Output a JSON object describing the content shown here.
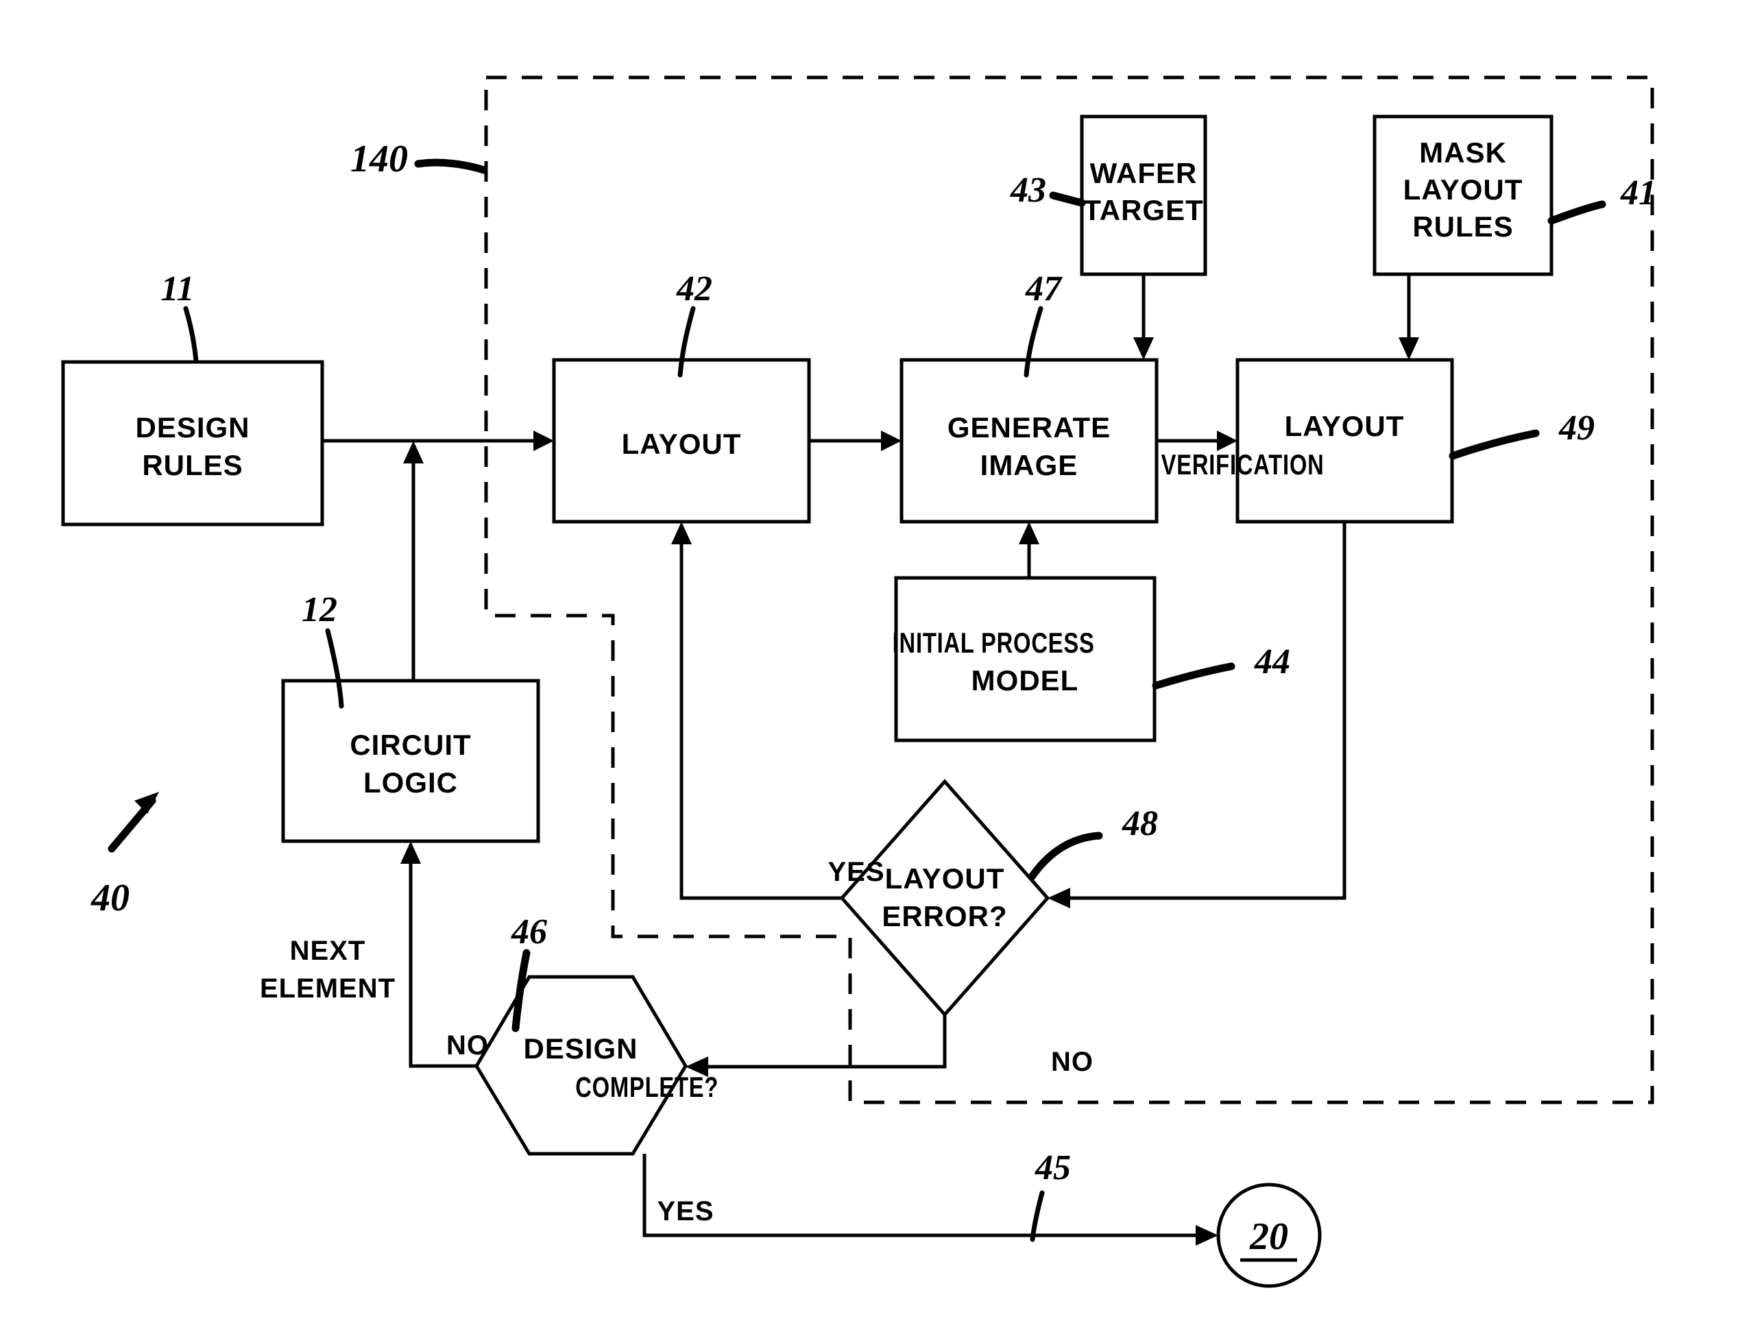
{
  "figure": {
    "type": "patent-flowchart",
    "system_ref": "40",
    "dashed_region_ref": "140"
  },
  "boxes": {
    "design_rules": {
      "label_line1": "DESIGN",
      "label_line2": "RULES",
      "ref": "11"
    },
    "circuit_logic": {
      "label_line1": "CIRCUIT",
      "label_line2": "LOGIC",
      "ref": "12"
    },
    "layout": {
      "label_line1": "LAYOUT",
      "ref": "42"
    },
    "generate_image": {
      "label_line1": "GENERATE",
      "label_line2": "IMAGE",
      "ref": "47"
    },
    "wafer_target": {
      "label_line1": "WAFER",
      "label_line2": "TARGET",
      "ref": "43"
    },
    "mask_layout_rules": {
      "label_line1": "MASK",
      "label_line2": "LAYOUT",
      "label_line3": "RULES",
      "ref": "41"
    },
    "layout_verification": {
      "label_line1": "LAYOUT",
      "label_line2": "VERIFICATION",
      "ref": "49"
    },
    "initial_process_model": {
      "label_line1": "INITIAL PROCESS",
      "label_line2": "MODEL",
      "ref": "44"
    }
  },
  "decisions": {
    "layout_error": {
      "label_line1": "LAYOUT",
      "label_line2": "ERROR?",
      "ref": "48",
      "yes_label": "YES",
      "no_label": "NO"
    },
    "design_complete": {
      "label_line1": "DESIGN",
      "label_line2": "COMPLETE?",
      "ref": "46",
      "yes_label": "YES",
      "no_label": "NO"
    }
  },
  "connector": {
    "terminal": {
      "label": "20",
      "ref": "45"
    }
  },
  "edge_labels": {
    "next_element_line1": "NEXT",
    "next_element_line2": "ELEMENT"
  },
  "colors": {
    "stroke": "#000000",
    "background": "#ffffff"
  }
}
